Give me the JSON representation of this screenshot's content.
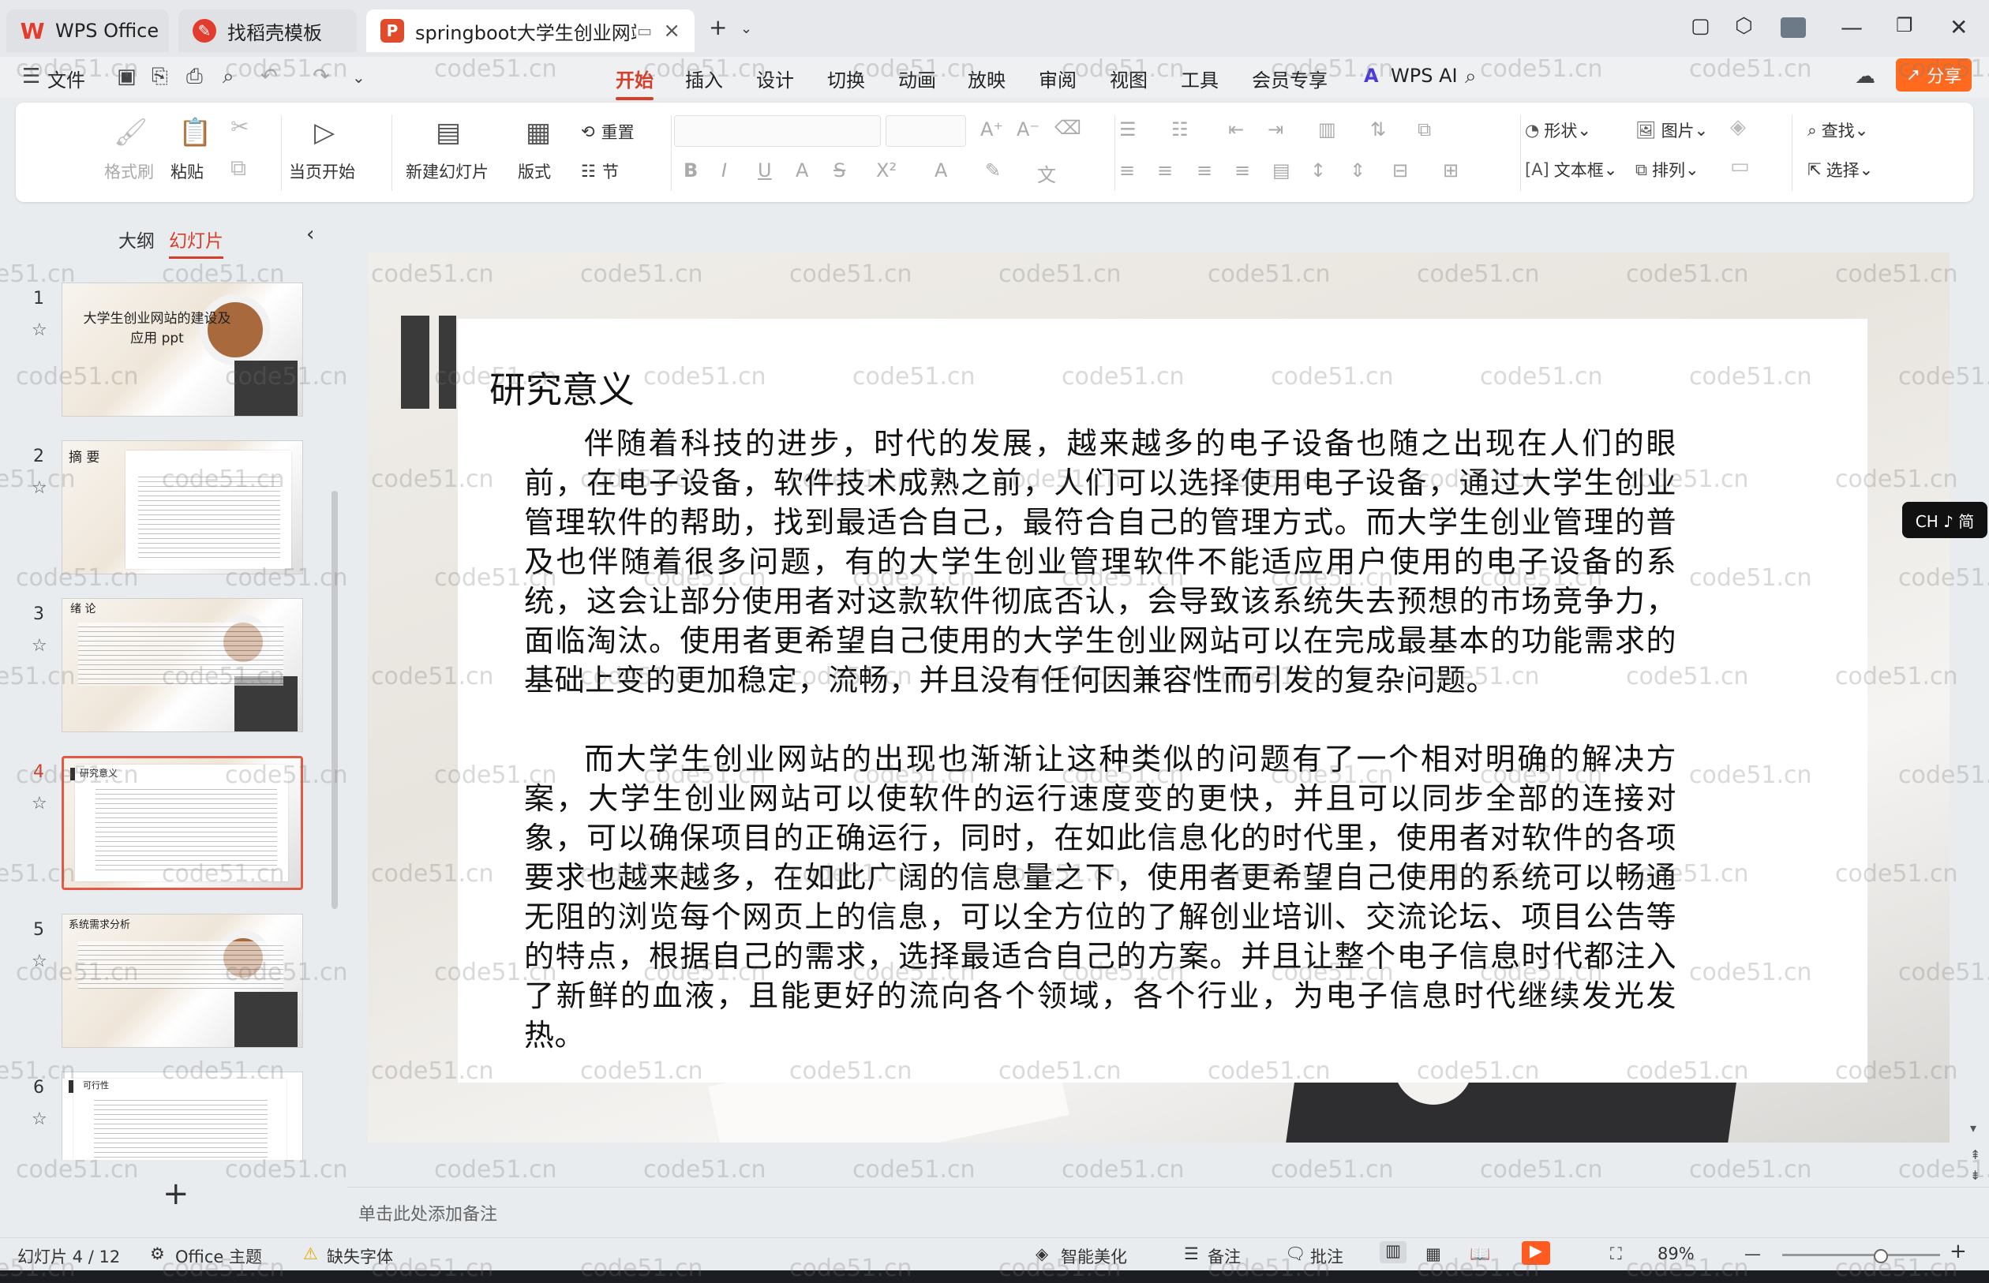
{
  "tabs": [
    {
      "label": "WPS Office",
      "icon": "wps-logo-icon"
    },
    {
      "label": "找稻壳模板",
      "icon": "docer-logo-icon"
    },
    {
      "label": "springboot大学生创业网站",
      "icon": "ppt-logo-icon",
      "active": true
    }
  ],
  "menu": {
    "file": "文件",
    "items": [
      "开始",
      "插入",
      "设计",
      "切换",
      "动画",
      "放映",
      "审阅",
      "视图",
      "工具",
      "会员专享"
    ],
    "active": "开始",
    "wps_ai": "WPS AI",
    "share": "分享"
  },
  "ribbon": {
    "format_painter": "格式刷",
    "paste": "粘贴",
    "from_current": "当页开始",
    "new_slide": "新建幻灯片",
    "layout": "版式",
    "reset": "重置",
    "section": "节",
    "shape": "形状",
    "picture": "图片",
    "find": "查找",
    "textbox": "文本框",
    "arrange": "排列",
    "select": "选择"
  },
  "left_panel": {
    "tab_outline": "大纲",
    "tab_slides": "幻灯片",
    "thumbnails": [
      {
        "num": "1",
        "title": "大学生创业网站的建设及应用 ppt"
      },
      {
        "num": "2",
        "title": "摘 要"
      },
      {
        "num": "3",
        "title": "绪 论"
      },
      {
        "num": "4",
        "title": "研究意义"
      },
      {
        "num": "5",
        "title": "系统需求分析"
      },
      {
        "num": "6",
        "title": "可行性"
      }
    ],
    "active_index": 4
  },
  "slide": {
    "title": "研究意义",
    "paragraph1": "伴随着科技的进步，时代的发展，越来越多的电子设备也随之出现在人们的眼前，在电子设备，软件技术成熟之前，人们可以选择使用电子设备，通过大学生创业管理软件的帮助，找到最适合自己，最符合自己的管理方式。而大学生创业管理的普及也伴随着很多问题，有的大学生创业管理软件不能适应用户使用的电子设备的系统，这会让部分使用者对这款软件彻底否认，会导致该系统失去预想的市场竞争力，面临淘汰。使用者更希望自己使用的大学生创业网站可以在完成最基本的功能需求的基础上变的更加稳定，流畅，并且没有任何因兼容性而引发的复杂问题。",
    "paragraph2": "而大学生创业网站的出现也渐渐让这种类似的问题有了一个相对明确的解决方案，大学生创业网站可以使软件的运行速度变的更快，并且可以同步全部的连接对象，可以确保项目的正确运行，同时，在如此信息化的时代里，使用者对软件的各项要求也越来越多，在如此广阔的信息量之下，使用者更希望自己使用的系统可以畅通无阻的浏览每个网页上的信息，可以全方位的了解创业培训、交流论坛、项目公告等的特点，根据自己的需求，选择最适合自己的方案。并且让整个电子信息时代都注入了新鲜的血液，且能更好的流向各个领域，各个行业，为电子信息时代继续发光发热。"
  },
  "notes_placeholder": "单击此处添加备注",
  "status": {
    "slide_counter": "幻灯片 4 / 12",
    "theme": "Office 主题",
    "missing_font": "缺失字体",
    "beautify": "智能美化",
    "notes": "备注",
    "comments": "批注",
    "zoom": "89%",
    "zoom_fraction": 0.62
  },
  "ime": "CH ♪ 简",
  "watermark": "code51.cn",
  "colors": {
    "accent": "#d43e2a",
    "share": "#ff6a1f"
  }
}
